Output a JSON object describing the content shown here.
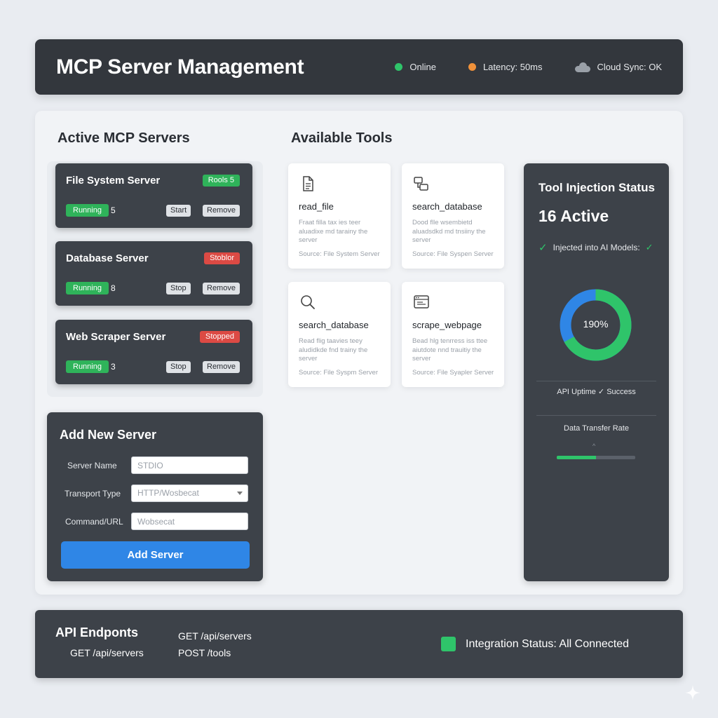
{
  "header": {
    "title": "MCP Server Management",
    "status": [
      {
        "label": "Online",
        "color": "#2fc46a",
        "icon": "status-dot"
      },
      {
        "label": "Latency: 50ms",
        "color": "#f0913a",
        "icon": "status-dot"
      },
      {
        "label": "Cloud Sync: OK",
        "color": "#9aa0a8",
        "icon": "cloud-icon"
      }
    ]
  },
  "servers": {
    "title": "Active MCP Servers",
    "items": [
      {
        "name": "File System Server",
        "badge": "Rools 5",
        "badge_color": "green",
        "state": "Running",
        "count": "5",
        "action": "Start",
        "remove": "Remove"
      },
      {
        "name": "Database Server",
        "badge": "Stoblor",
        "badge_color": "red",
        "state": "Running",
        "count": "8",
        "action": "Stop",
        "remove": "Remove"
      },
      {
        "name": "Web Scraper Server",
        "badge": "Stopped",
        "badge_color": "red",
        "state": "Running",
        "count": "3",
        "action": "Stop",
        "remove": "Remove"
      }
    ]
  },
  "add_server": {
    "title": "Add New Server",
    "fields": [
      {
        "label": "Server Name",
        "placeholder": "STDIO"
      },
      {
        "label": "Transport Type",
        "value": "HTTP/Wosbecat"
      },
      {
        "label": "Command/URL",
        "placeholder": "Wobsecat"
      }
    ],
    "submit": "Add Server"
  },
  "tools": {
    "title": "Available Tools",
    "items": [
      {
        "name": "read_file",
        "icon": "document-icon",
        "desc": "Fraat filla tax ies teer aluadixe md tarainy the server",
        "source": "Source: File System Server"
      },
      {
        "name": "search_database",
        "icon": "database-link-icon",
        "desc": "Dood flle wsembietd aluadsdkd md tnsiiny the server",
        "source": "Source: File Syspen Server"
      },
      {
        "name": "search_database",
        "icon": "search-icon",
        "desc": "Read flig taavies teey aludidkde fnd trainy the server",
        "source": "Source: File Syspm Server"
      },
      {
        "name": "scrape_webpage",
        "icon": "browser-window-icon",
        "desc": "Bead hlg tenrress iss ttee aiutdote nnd trauitiy the server",
        "source": "Source: File Syapler Server"
      }
    ]
  },
  "injection": {
    "title": "Tool Injection Status",
    "active": "16 Active",
    "injected": "Injected into AI Models:",
    "donut_label": "190%",
    "donut_fraction": 0.67,
    "donut_colors": {
      "primary": "#2fc46a",
      "secondary": "#2f86e6"
    },
    "uptime": "API Uptime ✓ Success",
    "transfer": "Data Transfer Rate",
    "transfer_marker": "^",
    "transfer_fraction": 0.5
  },
  "footer": {
    "title": "API Endponts",
    "endpoints": [
      "GET /api/servers",
      "GET /api/servers",
      "POST /tools"
    ],
    "integration": "Integration Status: All Connected"
  }
}
